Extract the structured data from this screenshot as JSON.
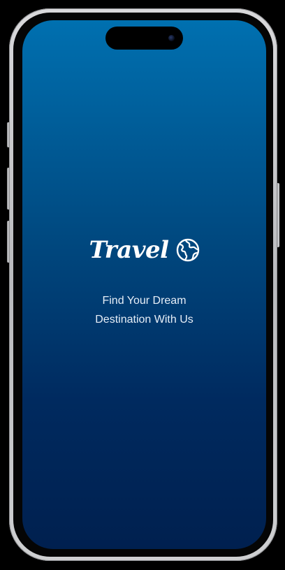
{
  "splash": {
    "brand_name": "Travel",
    "brand_icon": "globe-icon",
    "tagline_line1": "Find Your Dream",
    "tagline_line2": "Destination With Us"
  },
  "colors": {
    "gradient_top": "#0070b0",
    "gradient_bottom": "#00204f",
    "text": "#ffffff"
  }
}
